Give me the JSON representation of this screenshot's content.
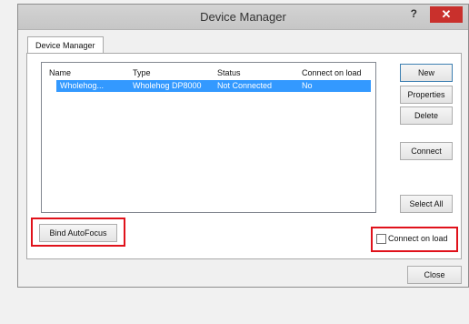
{
  "window": {
    "title": "Device Manager",
    "help_glyph": "?",
    "close_glyph": "✕"
  },
  "tab": {
    "label": "Device Manager"
  },
  "table": {
    "columns": [
      "Name",
      "Type",
      "Status",
      "Connect on load"
    ],
    "rows": [
      {
        "name": "Wholehog...",
        "type": "Wholehog DP8000",
        "status": "Not Connected",
        "connect_on_load": "No"
      }
    ]
  },
  "buttons": {
    "new": "New",
    "properties": "Properties",
    "delete": "Delete",
    "connect": "Connect",
    "select_all": "Select All",
    "bind_autofocus": "Bind AutoFocus",
    "close": "Close"
  },
  "checkbox": {
    "connect_on_load": "Connect on load",
    "checked": false
  },
  "highlight_color": "#e0121b"
}
